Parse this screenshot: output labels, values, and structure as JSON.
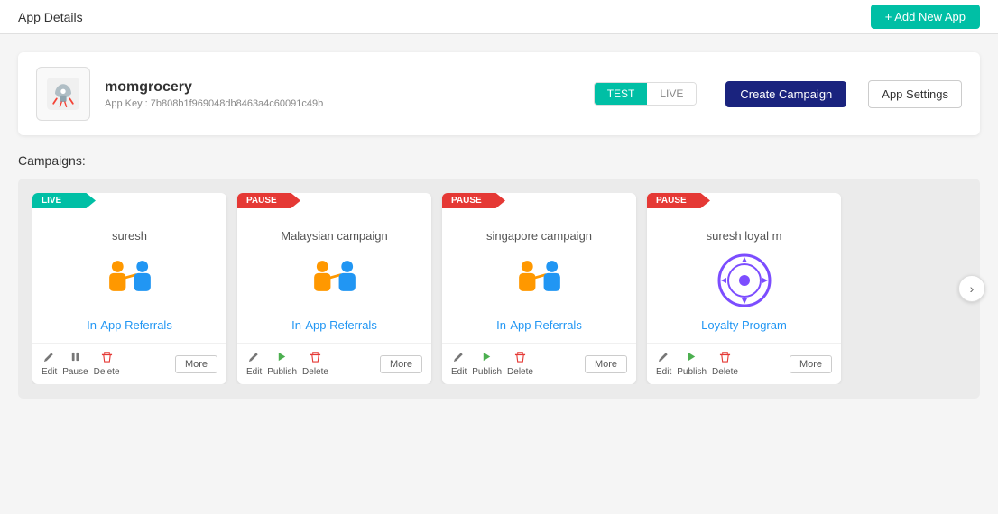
{
  "topbar": {
    "title": "App Details",
    "add_new_app": "+ Add New App"
  },
  "app": {
    "name": "momgrocery",
    "app_key_label": "App Key :",
    "app_key": "7b808b1f969048db8463a4c60091c49b",
    "toggle": {
      "options": [
        "TEST",
        "LIVE"
      ],
      "active": "TEST"
    },
    "create_campaign_label": "Create Campaign",
    "app_settings_label": "App Settings"
  },
  "campaigns_label": "Campaigns:",
  "campaigns": [
    {
      "id": 1,
      "badge": "LIVE",
      "badge_type": "live",
      "name": "suresh",
      "type": "In-App Referrals",
      "icon_type": "referral",
      "actions": [
        "Edit",
        "Pause",
        "Delete"
      ],
      "more": "More"
    },
    {
      "id": 2,
      "badge": "PAUSE",
      "badge_type": "pause",
      "name": "Malaysian campaign",
      "type": "In-App Referrals",
      "icon_type": "referral",
      "actions": [
        "Edit",
        "Publish",
        "Delete"
      ],
      "more": "More"
    },
    {
      "id": 3,
      "badge": "PAUSE",
      "badge_type": "pause",
      "name": "singapore campaign",
      "type": "In-App Referrals",
      "icon_type": "referral",
      "actions": [
        "Edit",
        "Publish",
        "Delete"
      ],
      "more": "More"
    },
    {
      "id": 4,
      "badge": "PAUSE",
      "badge_type": "pause",
      "name": "suresh loyal m",
      "type": "Loyalty Program",
      "icon_type": "loyalty",
      "actions": [
        "Edit",
        "Publish",
        "Delete"
      ],
      "more": "More"
    }
  ],
  "colors": {
    "teal": "#00bfa5",
    "navy": "#1a237e",
    "red": "#e53935",
    "blue": "#2196f3",
    "purple": "#7c4dff"
  }
}
